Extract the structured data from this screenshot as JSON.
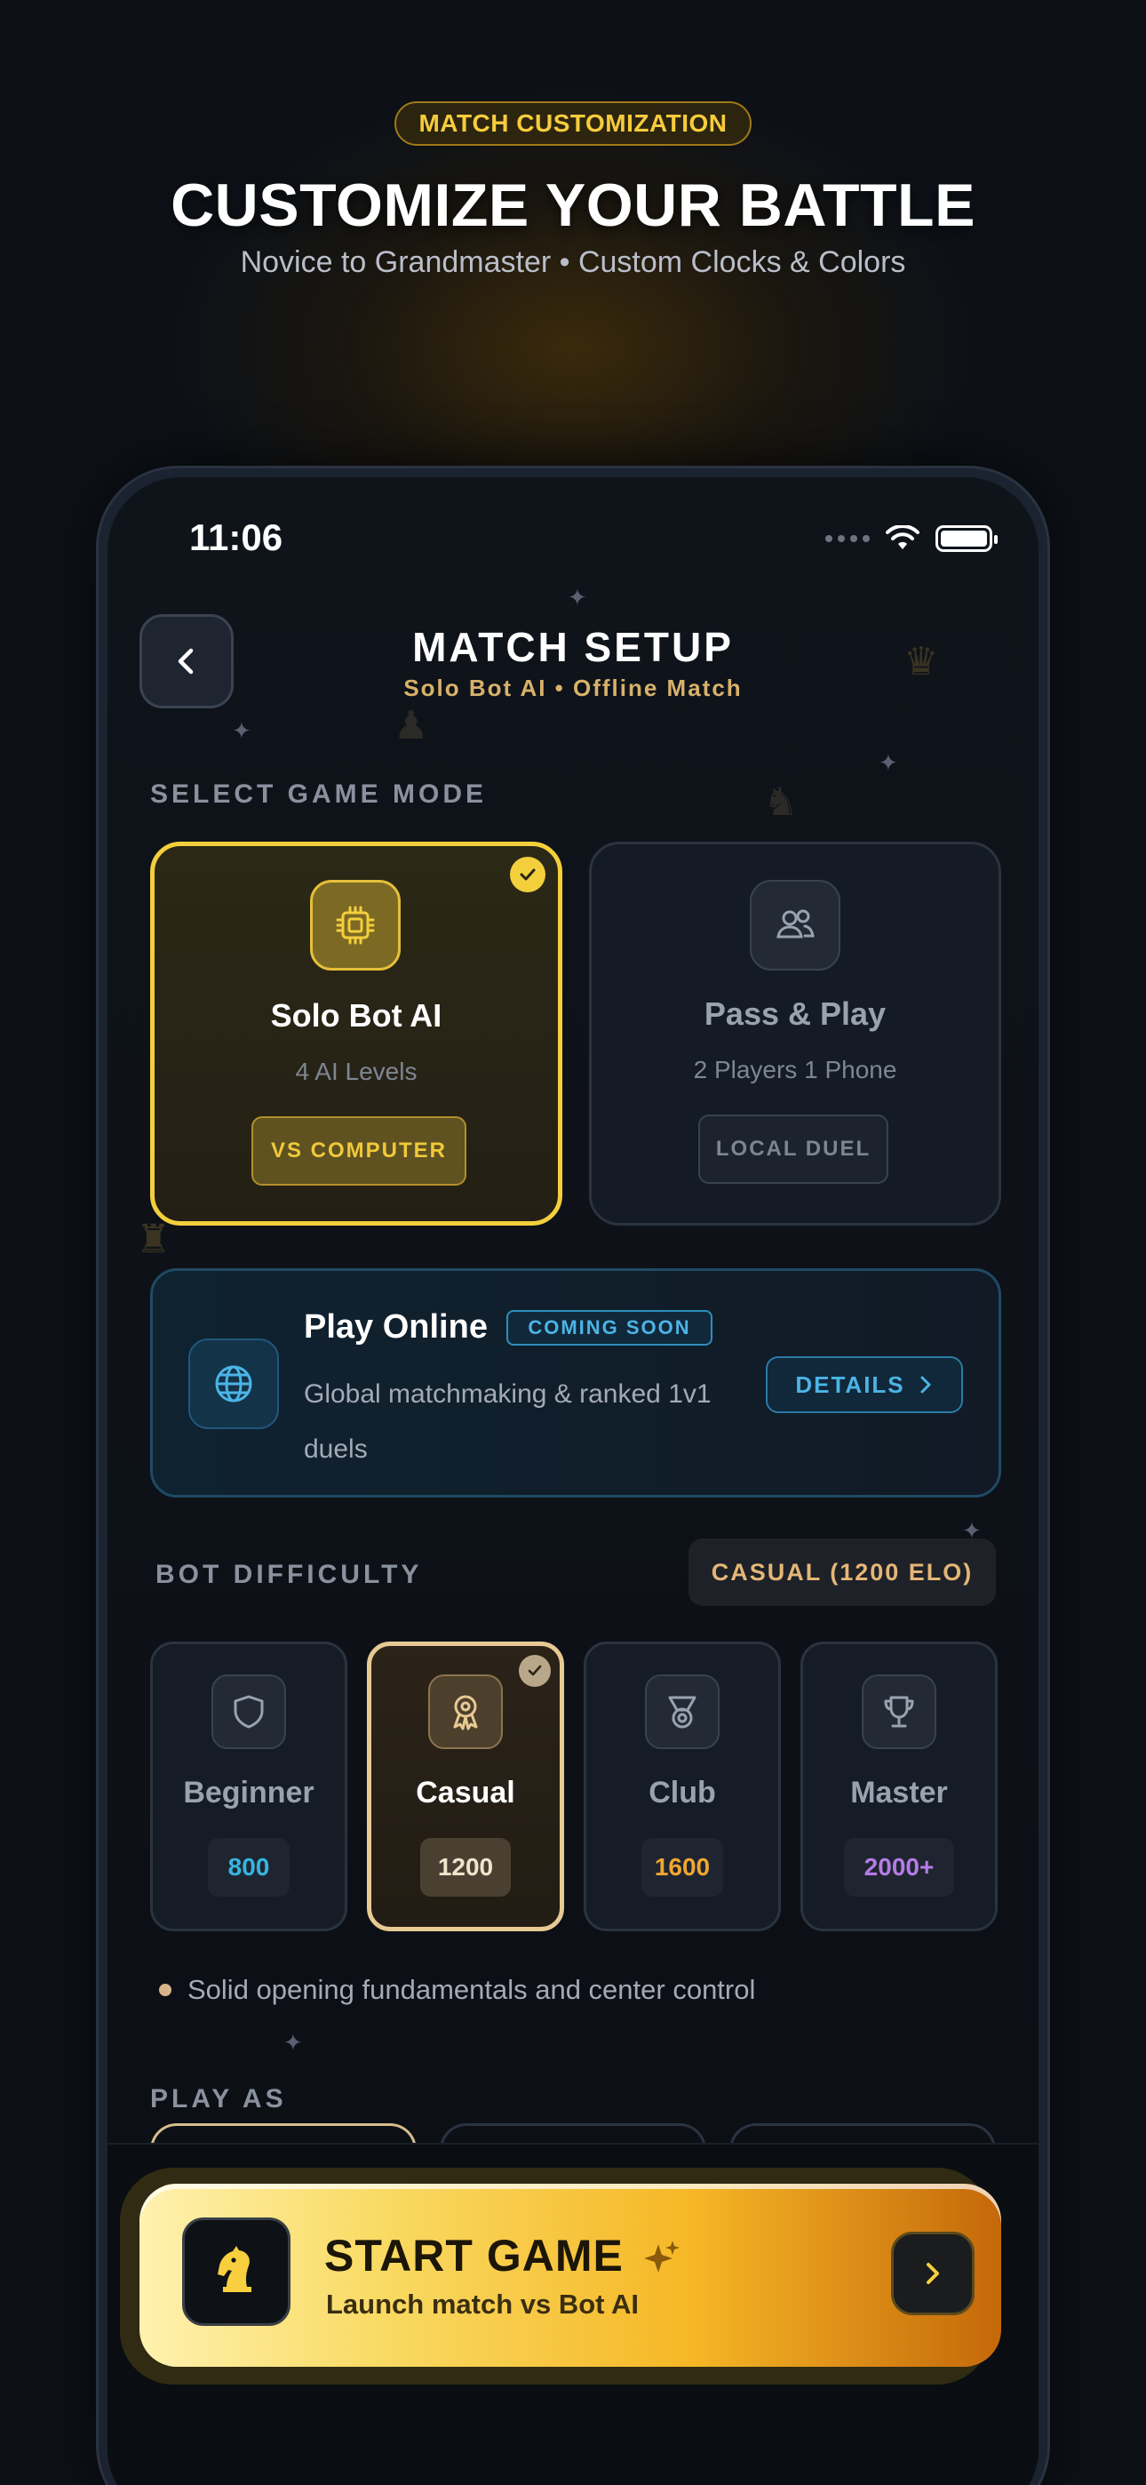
{
  "hero": {
    "badge": "MATCH CUSTOMIZATION",
    "title": "CUSTOMIZE YOUR BATTLE",
    "subtitle": "Novice to Grandmaster • Custom Clocks & Colors"
  },
  "status_bar": {
    "time": "11:06"
  },
  "header": {
    "title": "MATCH SETUP",
    "subtitle": "Solo Bot AI • Offline Match"
  },
  "game_mode": {
    "label": "SELECT GAME MODE",
    "modes": [
      {
        "title": "Solo Bot AI",
        "desc": "4 AI Levels",
        "tag": "VS COMPUTER",
        "selected": true,
        "icon": "cpu-icon"
      },
      {
        "title": "Pass & Play",
        "desc": "2 Players 1 Phone",
        "tag": "LOCAL DUEL",
        "selected": false,
        "icon": "users-icon"
      }
    ],
    "online": {
      "title": "Play Online",
      "badge": "COMING SOON",
      "desc": "Global matchmaking & ranked 1v1 duels",
      "button": "DETAILS",
      "icon": "globe-icon"
    }
  },
  "difficulty": {
    "label": "BOT DIFFICULTY",
    "selected_pill": "CASUAL (1200 ELO)",
    "levels": [
      {
        "name": "Beginner",
        "elo": "800",
        "color": "#35b5e0",
        "icon": "shield-icon",
        "selected": false
      },
      {
        "name": "Casual",
        "elo": "1200",
        "color": "#f0e4cc",
        "icon": "rosette-icon",
        "selected": true
      },
      {
        "name": "Club",
        "elo": "1600",
        "color": "#f0a630",
        "icon": "medal-icon",
        "selected": false
      },
      {
        "name": "Master",
        "elo": "2000+",
        "color": "#b47ce6",
        "icon": "trophy-icon",
        "selected": false
      }
    ],
    "hint": "Solid opening fundamentals and center control"
  },
  "play_as": {
    "label": "PLAY AS"
  },
  "start": {
    "title": "START GAME",
    "subtitle": "Launch match vs Bot AI"
  },
  "colors": {
    "accent_gold": "#f3cf3c",
    "accent_blue": "#4cb4e6",
    "accent_sand": "#e7c993"
  }
}
